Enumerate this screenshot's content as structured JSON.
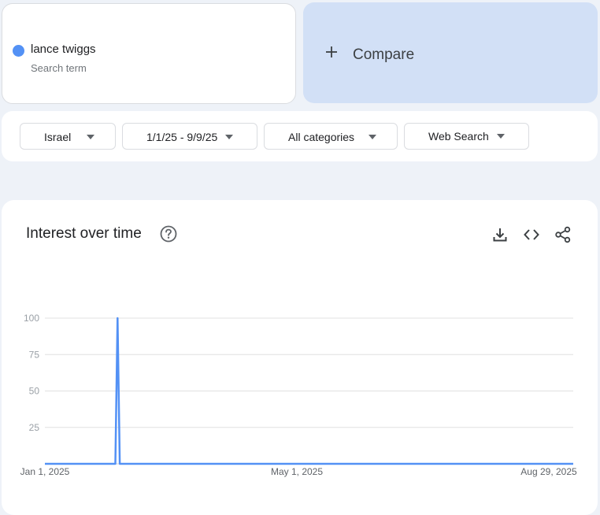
{
  "search_term": {
    "name": "lance twiggs",
    "subtitle": "Search term",
    "color": "#5391f5"
  },
  "compare": {
    "label": "Compare"
  },
  "filters": {
    "region": "Israel",
    "date_range": "1/1/25 - 9/9/25",
    "category": "All categories",
    "search_type": "Web Search"
  },
  "panel": {
    "title": "Interest over time",
    "icons": [
      "help-icon",
      "download-icon",
      "embed-code-icon",
      "share-icon"
    ]
  },
  "chart_data": {
    "type": "line",
    "x_start": "2025-01-01",
    "x_end": "2025-08-29",
    "x_tick_labels": [
      "Jan 1, 2025",
      "May 1, 2025",
      "Aug 29, 2025"
    ],
    "y_ticks": [
      25,
      50,
      75,
      100
    ],
    "ylim": [
      0,
      100
    ],
    "grid": true,
    "series": [
      {
        "name": "lance twiggs",
        "color": "#5391f5",
        "points": [
          [
            "2025-01-01",
            0
          ],
          [
            "2025-02-02",
            0
          ],
          [
            "2025-02-03",
            100
          ],
          [
            "2025-02-04",
            0
          ],
          [
            "2025-08-29",
            0
          ]
        ]
      }
    ]
  }
}
